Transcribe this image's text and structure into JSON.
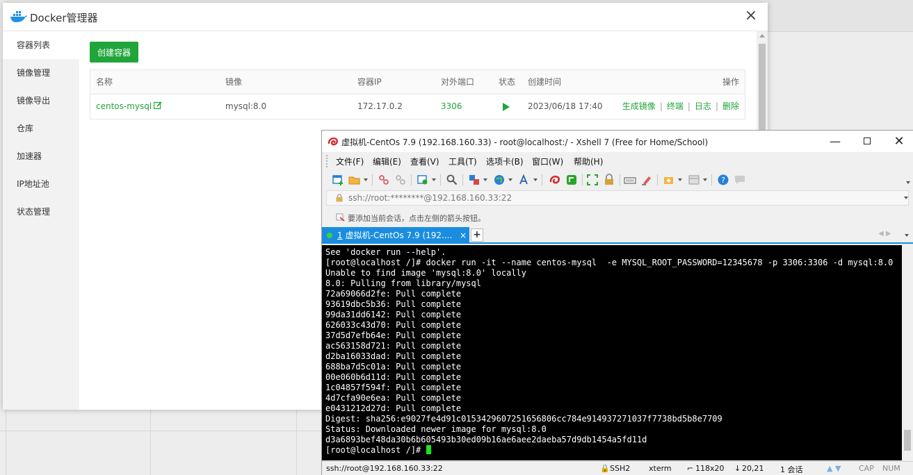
{
  "docker": {
    "title": "Docker管理器",
    "sidebar": [
      "容器列表",
      "镜像管理",
      "镜像导出",
      "仓库",
      "加速器",
      "IP地址池",
      "状态管理"
    ],
    "create_button": "创建容器",
    "table": {
      "headers": [
        "名称",
        "镜像",
        "容器IP",
        "对外端口",
        "状态",
        "创建时间",
        "操作"
      ],
      "row": {
        "name": "centos-mysql",
        "image": "mysql:8.0",
        "ip": "172.17.0.2",
        "port": "3306",
        "status": "running",
        "created": "2023/06/18 17:40",
        "actions": [
          "生成镜像",
          "终端",
          "日志",
          "删除"
        ]
      }
    },
    "accent_color": "#20a53a"
  },
  "xshell": {
    "title": "虚拟机-CentOs 7.9  (192.168.160.33)   - root@localhost:/ - Xshell 7 (Free for Home/School)",
    "menu": [
      "文件(F)",
      "编辑(E)",
      "查看(V)",
      "工具(T)",
      "选项卡(B)",
      "窗口(W)",
      "帮助(H)"
    ],
    "address": "ssh://root:********@192.168.160.33:22",
    "hint": "要添加当前会话，点击左侧的箭头按钮。",
    "tab": {
      "index": "1",
      "label": "虚拟机-CentOs 7.9  (192...."
    },
    "terminal_lines": [
      "See 'docker run --help'.",
      "[root@localhost /]# docker run -it --name centos-mysql  -e MYSQL_ROOT_PASSWORD=12345678 -p 3306:3306 -d mysql:8.0",
      "Unable to find image 'mysql:8.0' locally",
      "8.0: Pulling from library/mysql",
      "72a69066d2fe: Pull complete",
      "93619dbc5b36: Pull complete",
      "99da31dd6142: Pull complete",
      "626033c43d70: Pull complete",
      "37d5d7efb64e: Pull complete",
      "ac563158d721: Pull complete",
      "d2ba16033dad: Pull complete",
      "688ba7d5c01a: Pull complete",
      "00e060b6d11d: Pull complete",
      "1c04857f594f: Pull complete",
      "4d7cfa90e6ea: Pull complete",
      "e0431212d27d: Pull complete",
      "Digest: sha256:e9027fe4d91c0153429607251656806cc784e914937271037f7738bd5b8e7709",
      "Status: Downloaded newer image for mysql:8.0",
      "d3a6893bef48da30b6b605493b30ed09b16ae6aee2daeba57d9db1454a5fd11d"
    ],
    "prompt": "[root@localhost /]# ",
    "status": {
      "connection": "ssh://root@192.168.160.33:22",
      "protocol": "SSH2",
      "terminal": "xterm",
      "size": "118x20",
      "position": "20,21",
      "sessions": "1 会话",
      "cap": "CAP",
      "num": "NUM"
    },
    "accent_color": "#1a8de0",
    "cursor_color": "#19e619"
  }
}
